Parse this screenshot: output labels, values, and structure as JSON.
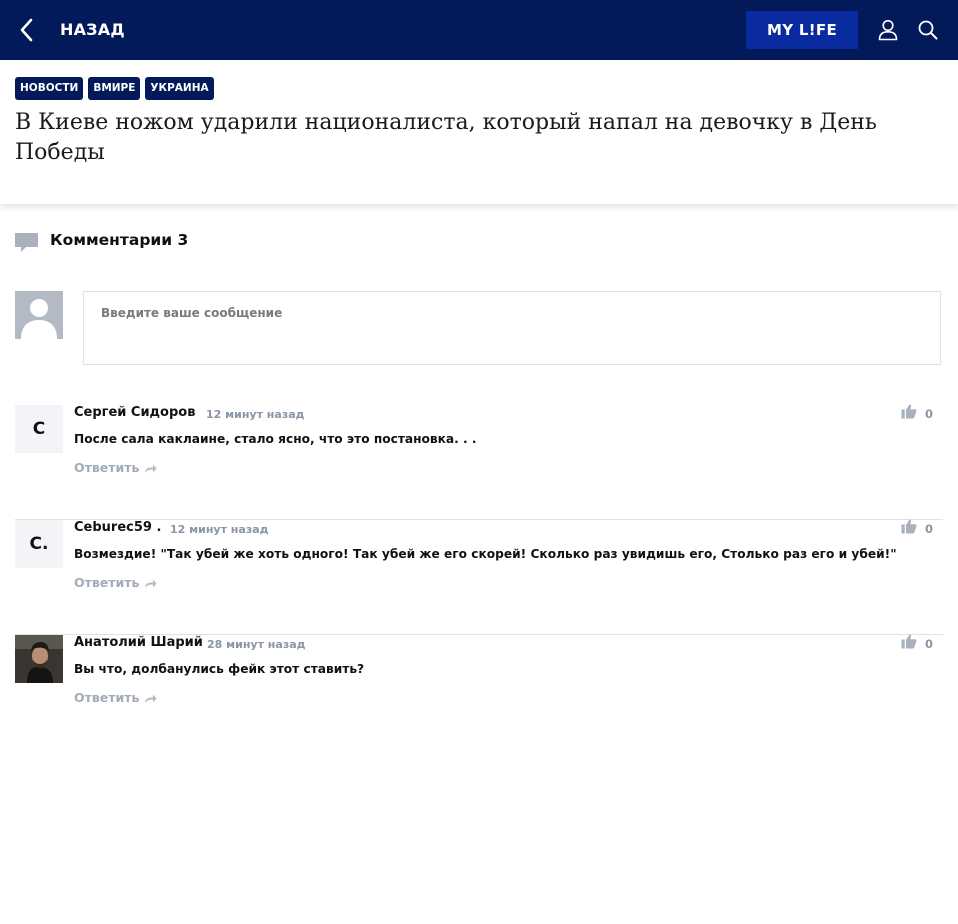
{
  "header": {
    "back_label": "НАЗАД",
    "brand_button": "MY L!FE",
    "icons": [
      "back-chevron-icon",
      "user-icon",
      "search-icon"
    ]
  },
  "article": {
    "tags": [
      "НОВОСТИ",
      "ВМИРЕ",
      "УКРАИНА"
    ],
    "title": "В Киеве ножом ударили националиста, который напал на девочку в День Победы"
  },
  "comments_section": {
    "title": "Комментарии 3",
    "input_placeholder": "Введите ваше сообщение",
    "items": [
      {
        "avatar_letter": "С",
        "author": "Сергей Сидоров",
        "time": "12 минут назад",
        "text": "После сала каклаине, стало ясно, что это постановка. . .",
        "reply_label": "Ответить",
        "likes": "0"
      },
      {
        "avatar_letter": "C.",
        "author": "Ceburec59 .",
        "time": "12 минут назад",
        "text": "Возмездие! \"Так убей же хоть одного! Так убей же его скорей! Сколько раз увидишь его, Столько раз его и убей!\"",
        "reply_label": "Ответить",
        "likes": "0"
      },
      {
        "avatar_letter": "",
        "author": "Анатолий Шарий",
        "time": "28 минут назад",
        "text": "Вы что, долбанулись фейк этот ставить?",
        "reply_label": "Ответить",
        "likes": "0"
      }
    ]
  },
  "colors": {
    "header_bg": "#031a5a",
    "brand_button_bg": "#0a2ba0",
    "muted_text": "#8a95a5"
  }
}
